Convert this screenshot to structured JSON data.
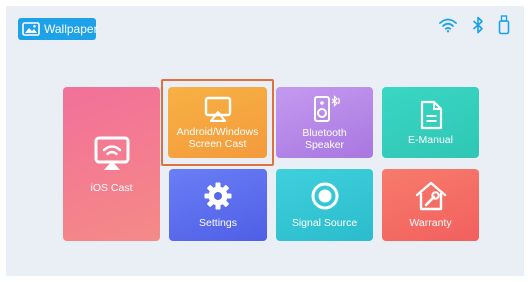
{
  "header": {
    "wallpaper_label": "Wallpaper",
    "icons": [
      "wifi-icon",
      "bluetooth-icon",
      "usb-drive-icon"
    ]
  },
  "tiles": {
    "ios_cast": {
      "label": "iOS Cast",
      "icon": "cast-screen-icon",
      "color": "#f0708f"
    },
    "android_cast": {
      "line1": "Android/Windows",
      "line2": "Screen Cast",
      "icon": "airplay-icon",
      "color": "#f7a43e",
      "focused": true
    },
    "bluetooth_speaker": {
      "line1": "Bluetooth",
      "line2": "Speaker",
      "icon": "speaker-icon",
      "color": "#b98be6"
    },
    "e_manual": {
      "label": "E-Manual",
      "icon": "document-icon",
      "color": "#35cfbc"
    },
    "settings": {
      "label": "Settings",
      "icon": "gear-icon",
      "color": "#5b6ff0"
    },
    "signal_source": {
      "label": "Signal Source",
      "icon": "signal-source-icon",
      "color": "#36c7d8"
    },
    "warranty": {
      "label": "Warranty",
      "icon": "house-wrench-icon",
      "color": "#f46a63"
    }
  },
  "colors": {
    "accent": "#1da1e8",
    "focus": "#e0703e",
    "background": "#eaeff6"
  }
}
